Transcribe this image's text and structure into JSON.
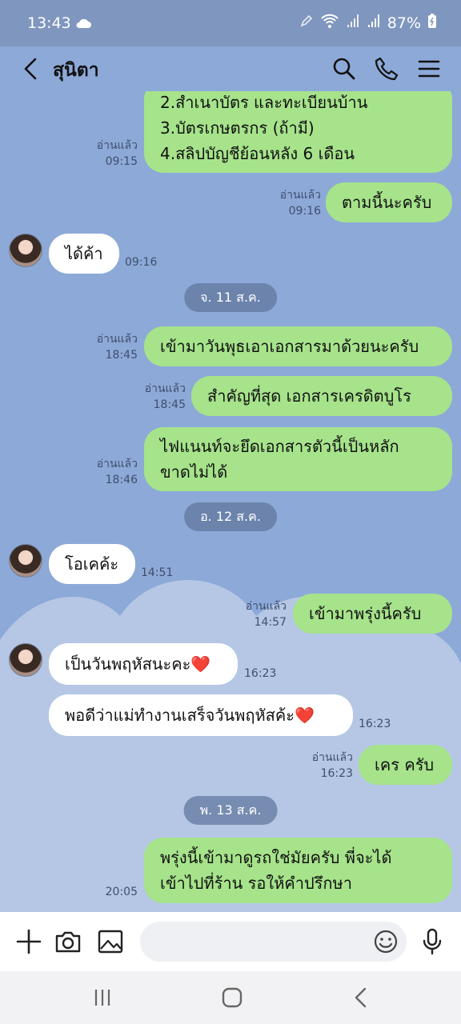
{
  "status_bar": {
    "time": "13:43",
    "battery": "87%",
    "icons": [
      "weather-cloud-icon",
      "pen-icon",
      "wifi-icon",
      "signal-icon",
      "battery-icon"
    ]
  },
  "header": {
    "contact_name": "สุนิตา",
    "icons": [
      "back-icon",
      "search-icon",
      "phone-icon",
      "menu-icon"
    ]
  },
  "read_label": "อ่านแล้ว",
  "messages": [
    {
      "dir": "out",
      "lines": [
        "2.สำเนาบัตร และทะเบียนบ้าน",
        "3.บัตรเกษตรกร (ถ้ามี)",
        "4.สลิปบัญชีย้อนหลัง 6 เดือน"
      ],
      "read": "อ่านแล้ว",
      "time": "09:15"
    },
    {
      "dir": "out",
      "lines": [
        "ตามนี้นะครับ"
      ],
      "read": "อ่านแล้ว",
      "time": "09:16"
    },
    {
      "dir": "in",
      "lines": [
        "ได้ค้า"
      ],
      "time": "09:16"
    },
    {
      "date": "จ. 11 ส.ค."
    },
    {
      "dir": "out",
      "lines": [
        "เข้ามาวันพุธเอาเอกสารมาด้วยนะครับ"
      ],
      "read": "อ่านแล้ว",
      "time": "18:45"
    },
    {
      "dir": "out",
      "lines": [
        "สำคัญที่สุด เอกสารเครดิตบูโร"
      ],
      "read": "อ่านแล้ว",
      "time": "18:45"
    },
    {
      "dir": "out",
      "lines": [
        "ไฟแนนท์จะยึดเอกสารตัวนี้เป็นหลัก",
        "ขาดไม่ได้"
      ],
      "read": "อ่านแล้ว",
      "time": "18:46"
    },
    {
      "date": "อ. 12 ส.ค."
    },
    {
      "dir": "in",
      "lines": [
        "โอเคค้ะ"
      ],
      "time": "14:51"
    },
    {
      "dir": "out",
      "lines": [
        "เข้ามาพรุ่งนี้ครับ"
      ],
      "read": "อ่านแล้ว",
      "time": "14:57"
    },
    {
      "dir": "in",
      "lines": [
        "เป็นวันพฤหัสนะคะ❤️"
      ],
      "time": "16:23"
    },
    {
      "dir": "in",
      "lines": [
        "พอดีว่าแม่ทำงานเสร็จวันพฤหัสค้ะ❤️"
      ],
      "time": "16:23"
    },
    {
      "dir": "out",
      "lines": [
        "เคร ครับ"
      ],
      "read": "อ่านแล้ว",
      "time": "16:23"
    },
    {
      "date": "พ. 13 ส.ค."
    },
    {
      "dir": "out",
      "lines": [
        "พรุ่งนี้เข้ามาดูรถใช่มัยครับ พี่จะได้",
        "เข้าไปที่ร้าน รอให้คำปรึกษา"
      ],
      "time": "20:05"
    }
  ],
  "input_bar": {
    "placeholder": "",
    "icons": [
      "plus-icon",
      "camera-icon",
      "image-icon",
      "emoji-icon",
      "mic-icon"
    ]
  },
  "nav_bar": {
    "icons": [
      "recents-icon",
      "home-icon",
      "back-nav-icon"
    ]
  },
  "colors": {
    "chat_bg": "#8DA9D8",
    "outgoing_bubble": "#A6E38B",
    "incoming_bubble": "#FFFFFF",
    "date_pill": "#62789E",
    "status_bar": "#7F96BE"
  }
}
